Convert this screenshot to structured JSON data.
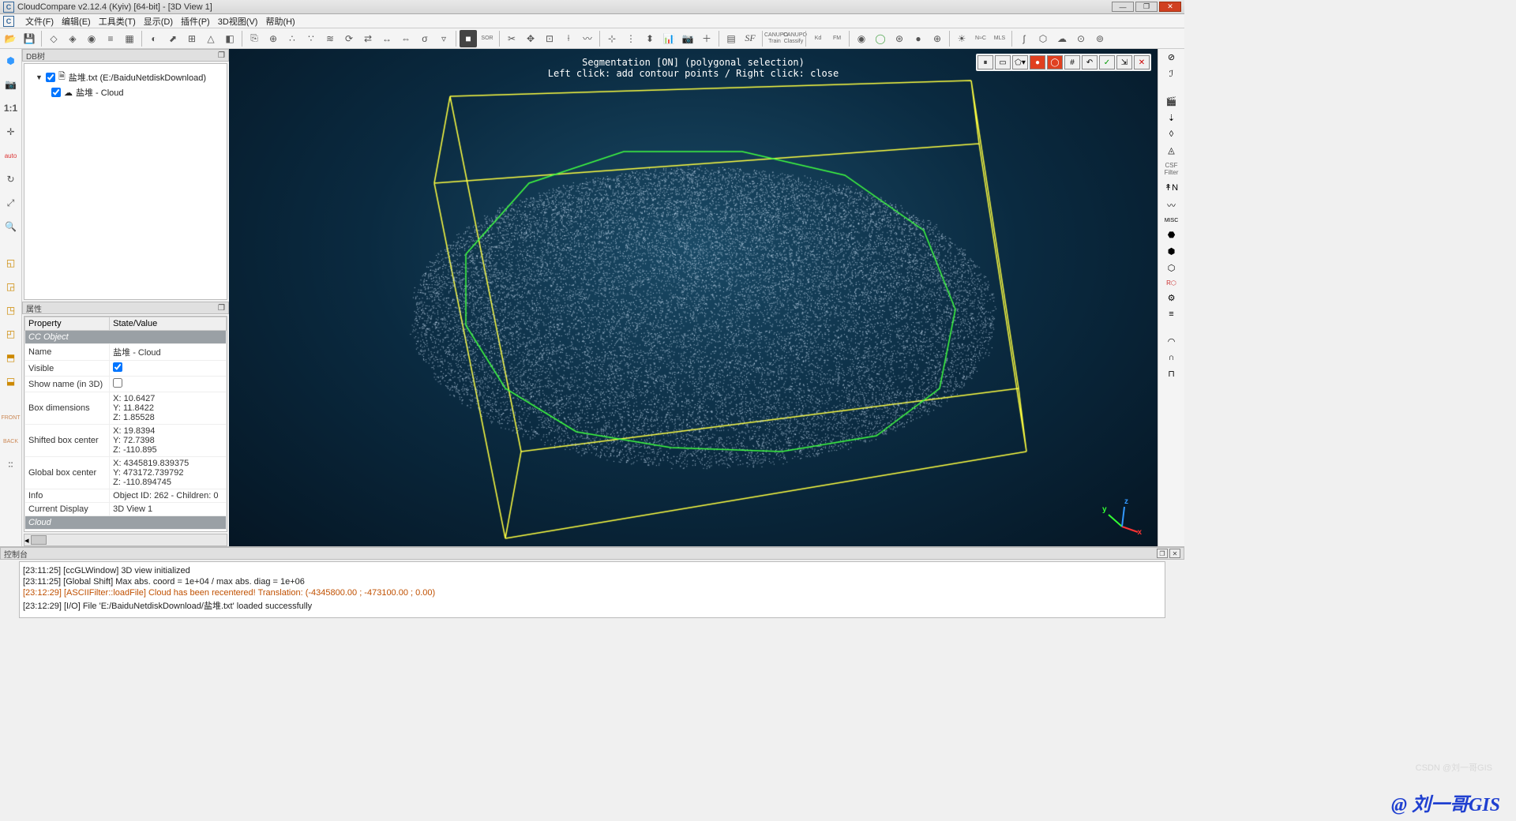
{
  "title": "CloudCompare v2.12.4 (Kyiv) [64-bit] - [3D View 1]",
  "menu": [
    "文件(F)",
    "编辑(E)",
    "工具类(T)",
    "显示(D)",
    "插件(P)",
    "3D视图(V)",
    "帮助(H)"
  ],
  "toolbar_labels": {
    "sor": "SOR",
    "kd": "Kd",
    "fm": "FM",
    "nc": "N≈C",
    "mls": "MLS"
  },
  "dbtree": {
    "header": "DB树",
    "root": "盐堆.txt (E:/BaiduNetdiskDownload)",
    "child": "盐堆 - Cloud"
  },
  "props": {
    "header": "属性",
    "col_prop": "Property",
    "col_val": "State/Value",
    "section1": "CC Object",
    "name_l": "Name",
    "name_v": "盐堆 - Cloud",
    "vis_l": "Visible",
    "show_l": "Show name (in 3D)",
    "boxdim_l": "Box dimensions",
    "boxdim_v": "X: 10.6427\nY: 11.8422\nZ: 1.85528",
    "shift_l": "Shifted box center",
    "shift_v": "X: 19.8394\nY: 72.7398\nZ: -110.895",
    "global_l": "Global box center",
    "global_v": "X: 4345819.839375\nY: 473172.739792\nZ: -110.894745",
    "info_l": "Info",
    "info_v": "Object ID: 262 - Children: 0",
    "disp_l": "Current Display",
    "disp_v": "3D View 1",
    "section2": "Cloud"
  },
  "overlay": {
    "line1": "Segmentation [ON] (polygonal selection)",
    "line2": "Left click: add contour points / Right click: close"
  },
  "console": {
    "header": "控制台",
    "l1": "[23:11:25] [ccGLWindow] 3D view initialized",
    "l2": "[23:11:25] [Global Shift] Max abs. coord = 1e+04 / max abs. diag = 1e+06",
    "l3": "[23:12:29] [ASCIIFilter::loadFile] Cloud has been recentered! Translation: (-4345800.00 ; -473100.00 ; 0.00)",
    "l4": "[23:12:29] [I/O] File 'E:/BaiduNetdiskDownload/盐堆.txt' loaded successfully"
  },
  "right_label": "CSF Filter",
  "watermark": "@ 刘一哥GIS",
  "watermark2": "CSDN @刘一哥GIS"
}
